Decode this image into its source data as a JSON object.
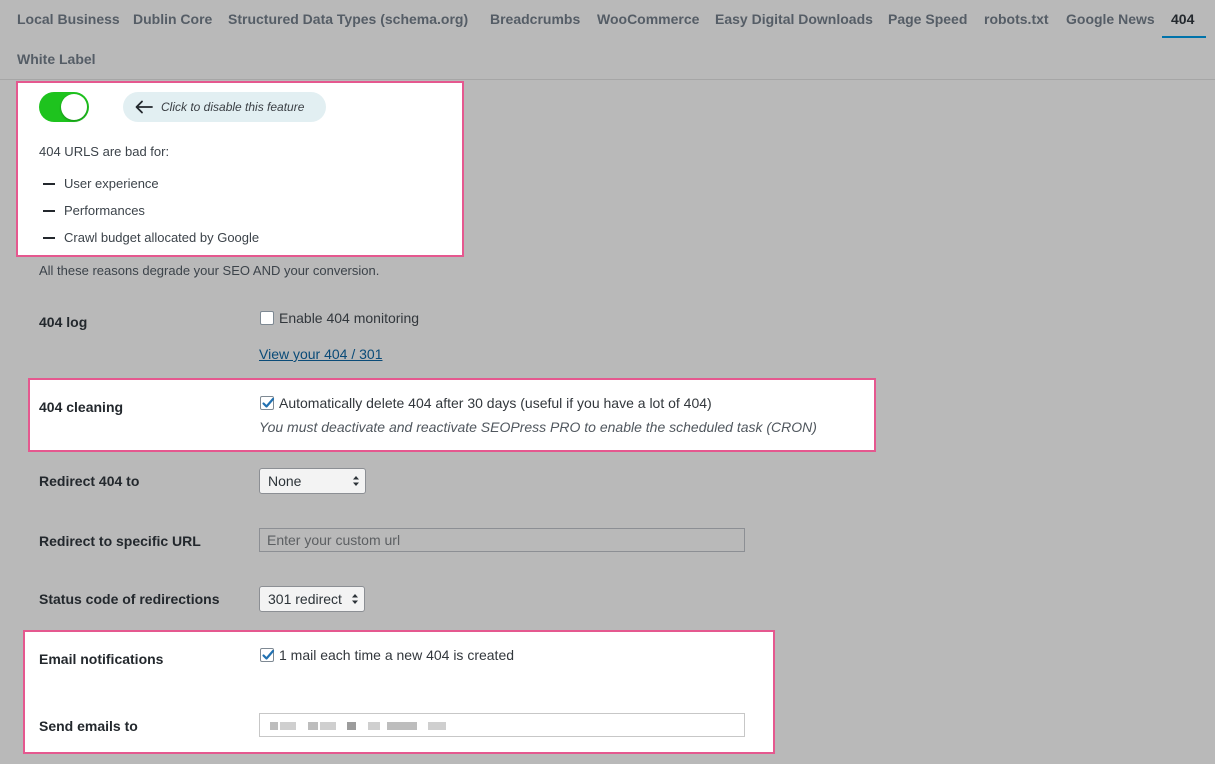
{
  "tabs": [
    {
      "label": "Local Business",
      "active": false
    },
    {
      "label": "Dublin Core",
      "active": false
    },
    {
      "label": "Structured Data Types (schema.org)",
      "active": false
    },
    {
      "label": "Breadcrumbs",
      "active": false
    },
    {
      "label": "WooCommerce",
      "active": false
    },
    {
      "label": "Easy Digital Downloads",
      "active": false
    },
    {
      "label": "Page Speed",
      "active": false
    },
    {
      "label": "robots.txt",
      "active": false
    },
    {
      "label": "Google News",
      "active": false
    },
    {
      "label": "404",
      "active": true
    },
    {
      "label": "White Label",
      "active": false
    }
  ],
  "feature": {
    "enabled": true,
    "hint": "Click to disable this feature",
    "intro": "404 URLS are bad for:",
    "reasons": [
      "User experience",
      "Performances",
      "Crawl budget allocated by Google"
    ],
    "conclusion": "All these reasons degrade your SEO AND your conversion."
  },
  "settings": {
    "log": {
      "label": "404 log",
      "checkbox_label": "Enable 404 monitoring",
      "checked": false,
      "link": "View your 404 / 301"
    },
    "cleaning": {
      "label": "404 cleaning",
      "checkbox_label": "Automatically delete 404 after 30 days (useful if you have a lot of 404)",
      "checked": true,
      "description": "You must deactivate and reactivate SEOPress PRO to enable the scheduled task (CRON)"
    },
    "redirect": {
      "label": "Redirect 404 to",
      "value": "None"
    },
    "redirect_url": {
      "label": "Redirect to specific URL",
      "placeholder": "Enter your custom url"
    },
    "status_code": {
      "label": "Status code of redirections",
      "value": "301 redirect"
    },
    "email": {
      "label": "Email notifications",
      "checkbox_label": "1 mail each time a new 404 is created",
      "checked": true
    },
    "send_to": {
      "label": "Send emails to"
    }
  },
  "colors": {
    "toggle_on": "#1ec31e",
    "highlight_border": "#e5588f",
    "link": "#0a4b78",
    "active_tab_underline": "#0073aa"
  }
}
